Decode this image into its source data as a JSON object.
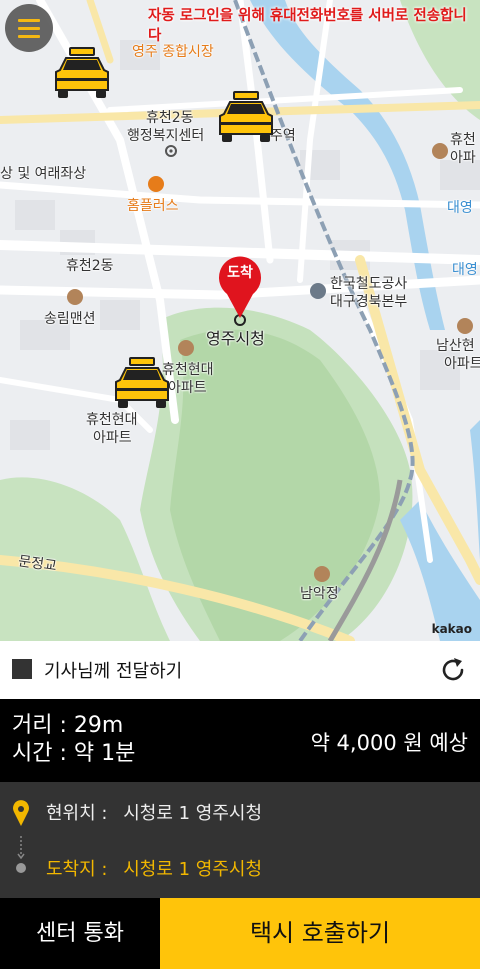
{
  "notice": "자동 로그인을 위해 휴대전화번호를 서버로 전송합니다",
  "map": {
    "labels": {
      "market": "영주 종합시장",
      "welfare_1": "휴천2동",
      "welfare_2": "행정복지센터",
      "station": "주역",
      "shopping": "상 및 여래좌상",
      "homeplus": "홈플러스",
      "hyucheon2": "휴천2동",
      "songrim": "송림맨션",
      "cityhall": "영주시청",
      "apt_a": "휴천현대",
      "apt_b": "아파트",
      "apt_c1": "휴천현대",
      "apt_c2": "아파트",
      "korail_1": "한국철도공사",
      "korail_2": "대구경북본부",
      "right_apt1": "휴천",
      "right_apt2": "아파",
      "daeyeong_1": "대영",
      "daeyeong_2": "대영",
      "namsan_1": "남산현",
      "namsan_2": "아파트",
      "munjeong": "문정교",
      "namak": "남악정"
    },
    "destination_pin": "도착",
    "attribution": "kakao"
  },
  "deliver": {
    "label": "기사님께 전달하기"
  },
  "info": {
    "distance": "거리 : 29m",
    "time": "시간 : 약 1분",
    "fare": "약 4,000 원 예상"
  },
  "route": {
    "current_label": "현위치 :",
    "current_value": "시청로 1 영주시청",
    "dest_label": "도착지 :",
    "dest_value": "시청로 1 영주시청"
  },
  "buttons": {
    "center_call": "센터 통화",
    "call_taxi": "택시 호출하기"
  },
  "colors": {
    "accent_yellow": "#ffc40a",
    "notice_red": "#e01a1a",
    "pin_red": "#e0141e",
    "dest_text": "#f2b700"
  }
}
